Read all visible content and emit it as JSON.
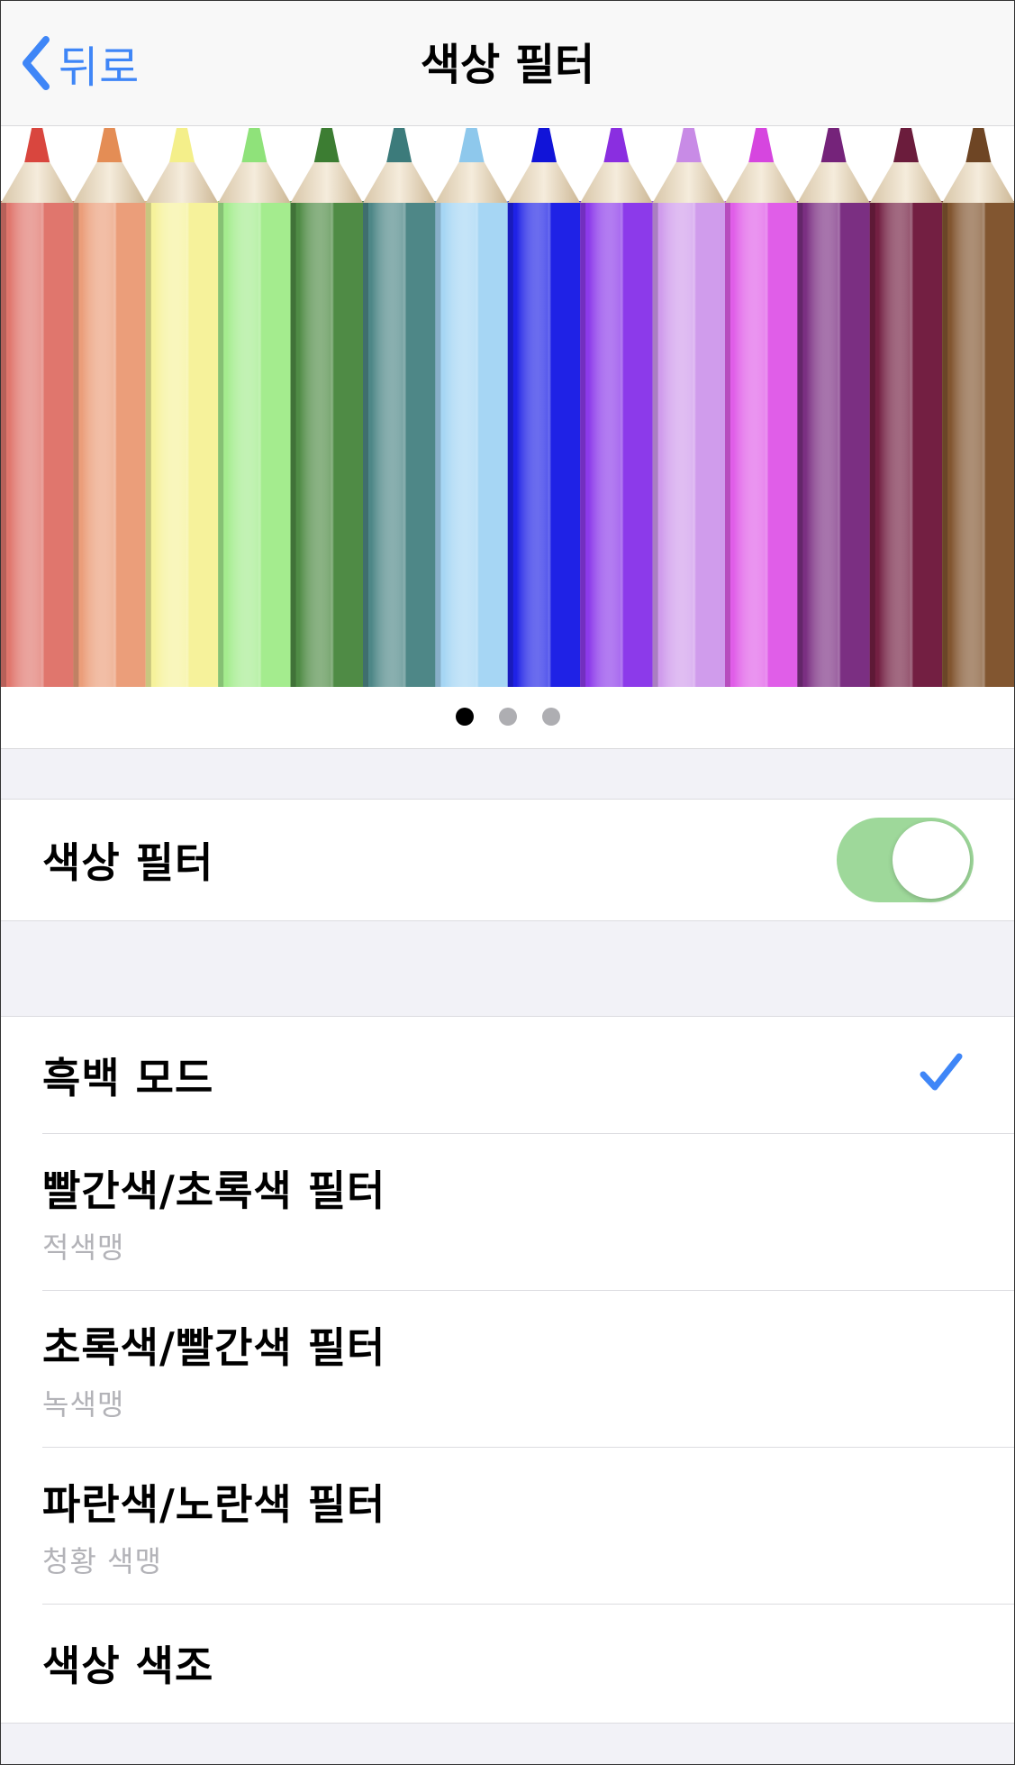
{
  "navbar": {
    "back_label": "뒤로",
    "title": "색상 필터"
  },
  "banner": {
    "pencil_colors": [
      {
        "tip": "#d9463e",
        "body": "#e0766d"
      },
      {
        "tip": "#e48d55",
        "body": "#eb9e7a"
      },
      {
        "tip": "#f4ef8a",
        "body": "#f6f29b"
      },
      {
        "tip": "#8fe27a",
        "body": "#a4ec8e"
      },
      {
        "tip": "#3c7d32",
        "body": "#4f8b45"
      },
      {
        "tip": "#3c7b7b",
        "body": "#4e8787"
      },
      {
        "tip": "#8ec8ec",
        "body": "#a6d6f4"
      },
      {
        "tip": "#1114d8",
        "body": "#1f22e6"
      },
      {
        "tip": "#8a2ee0",
        "body": "#8c3aea"
      },
      {
        "tip": "#c88be6",
        "body": "#d09cec"
      },
      {
        "tip": "#d646df",
        "body": "#e05ee8"
      },
      {
        "tip": "#75237a",
        "body": "#7b2f82"
      },
      {
        "tip": "#6b1c3c",
        "body": "#731f42"
      },
      {
        "tip": "#6e4524",
        "body": "#825630"
      }
    ],
    "page_dots": 3,
    "active_dot": 0
  },
  "filter_toggle": {
    "label": "색상 필터",
    "on": true,
    "on_color": "#9ed89a"
  },
  "options": [
    {
      "label": "흑백 모드",
      "sub": "",
      "checked": true
    },
    {
      "label": "빨간색/초록색 필터",
      "sub": "적색맹",
      "checked": false
    },
    {
      "label": "초록색/빨간색 필터",
      "sub": "녹색맹",
      "checked": false
    },
    {
      "label": "파란색/노란색 필터",
      "sub": "청황 색맹",
      "checked": false
    },
    {
      "label": "색상 색조",
      "sub": "",
      "checked": false
    }
  ],
  "accent_color": "#3f86f7"
}
